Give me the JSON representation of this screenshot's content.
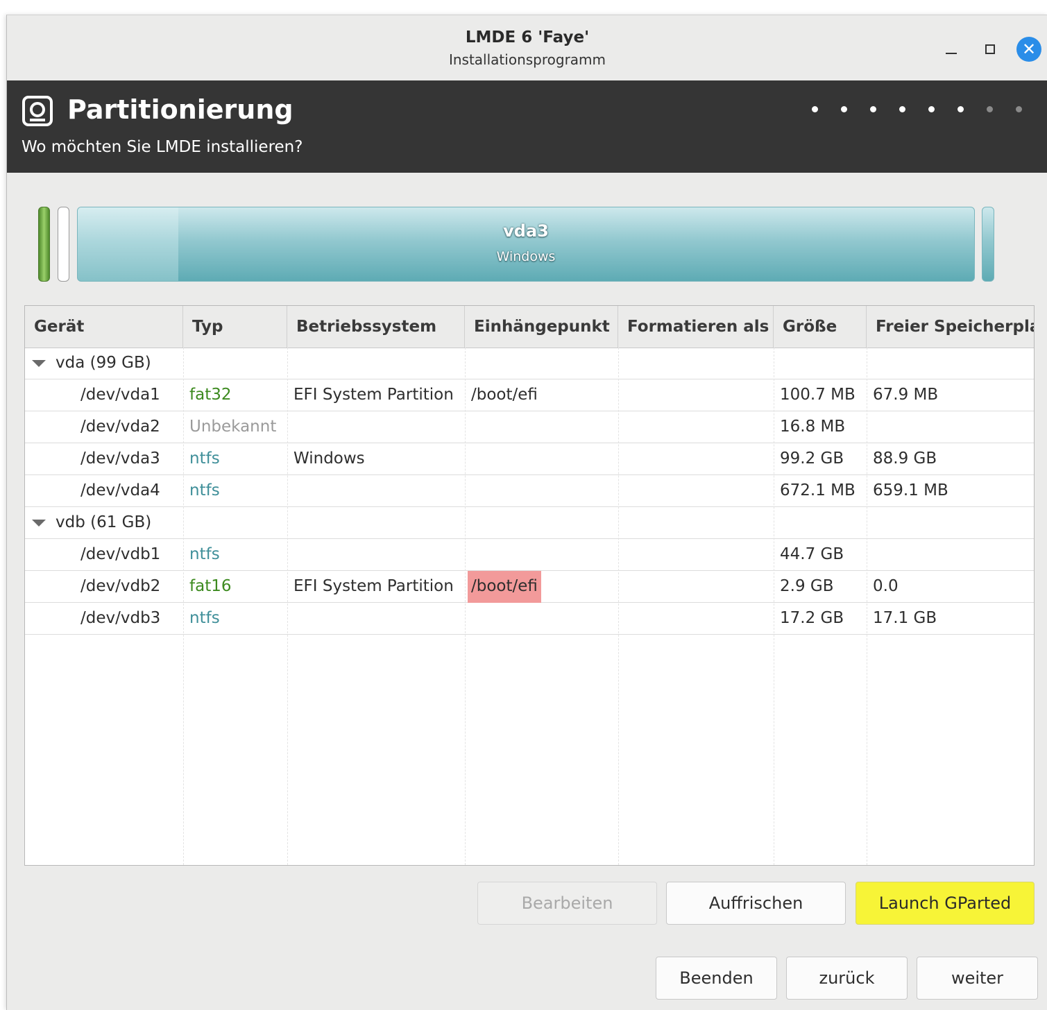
{
  "window": {
    "title": "LMDE 6 'Faye'",
    "subtitle": "Installationsprogramm",
    "close_symbol": "✕"
  },
  "header": {
    "title": "Partitionierung",
    "subtitle": "Wo möchten Sie LMDE installieren?",
    "icon": "disk-icon",
    "progress": {
      "total_steps": 8,
      "current_step": 6
    }
  },
  "diskbar": {
    "selected_label": "vda3",
    "selected_fs": "Windows"
  },
  "table": {
    "columns": [
      "Gerät",
      "Typ",
      "Betriebssystem",
      "Einhängepunkt",
      "Formatieren als",
      "Größe",
      "Freier Speicherplatz"
    ],
    "disks": [
      {
        "label": "vda (99 GB)",
        "partitions": [
          {
            "device": "/dev/vda1",
            "type": "fat32",
            "os": "EFI System Partition",
            "mount": "/boot/efi",
            "format": "",
            "size": "100.7 MB",
            "free": "67.9 MB"
          },
          {
            "device": "/dev/vda2",
            "type": "Unbekannt",
            "os": "",
            "mount": "",
            "format": "",
            "size": "16.8 MB",
            "free": ""
          },
          {
            "device": "/dev/vda3",
            "type": "ntfs",
            "os": "Windows",
            "mount": "",
            "format": "",
            "size": "99.2 GB",
            "free": "88.9 GB"
          },
          {
            "device": "/dev/vda4",
            "type": "ntfs",
            "os": "",
            "mount": "",
            "format": "",
            "size": "672.1 MB",
            "free": "659.1 MB"
          }
        ]
      },
      {
        "label": "vdb (61 GB)",
        "partitions": [
          {
            "device": "/dev/vdb1",
            "type": "ntfs",
            "os": "",
            "mount": "",
            "format": "",
            "size": "44.7 GB",
            "free": ""
          },
          {
            "device": "/dev/vdb2",
            "type": "fat16",
            "os": "EFI System Partition",
            "mount": "/boot/efi",
            "format": "",
            "size": "2.9 GB",
            "free": "0.0"
          },
          {
            "device": "/dev/vdb3",
            "type": "ntfs",
            "os": "",
            "mount": "",
            "format": "",
            "size": "17.2 GB",
            "free": "17.1 GB"
          }
        ]
      }
    ]
  },
  "buttons": {
    "edit": "Bearbeiten",
    "refresh": "Auffrischen",
    "gparted": "Launch GParted",
    "quit": "Beenden",
    "back": "zurück",
    "next": "weiter"
  },
  "colors": {
    "header_bg": "#353535",
    "accent_close": "#2a8de8",
    "gparted_button": "#f7f437",
    "mount_conflict": "#f29a9a",
    "fs_fat": "#3c8a1f",
    "fs_ntfs": "#3f8f99"
  }
}
